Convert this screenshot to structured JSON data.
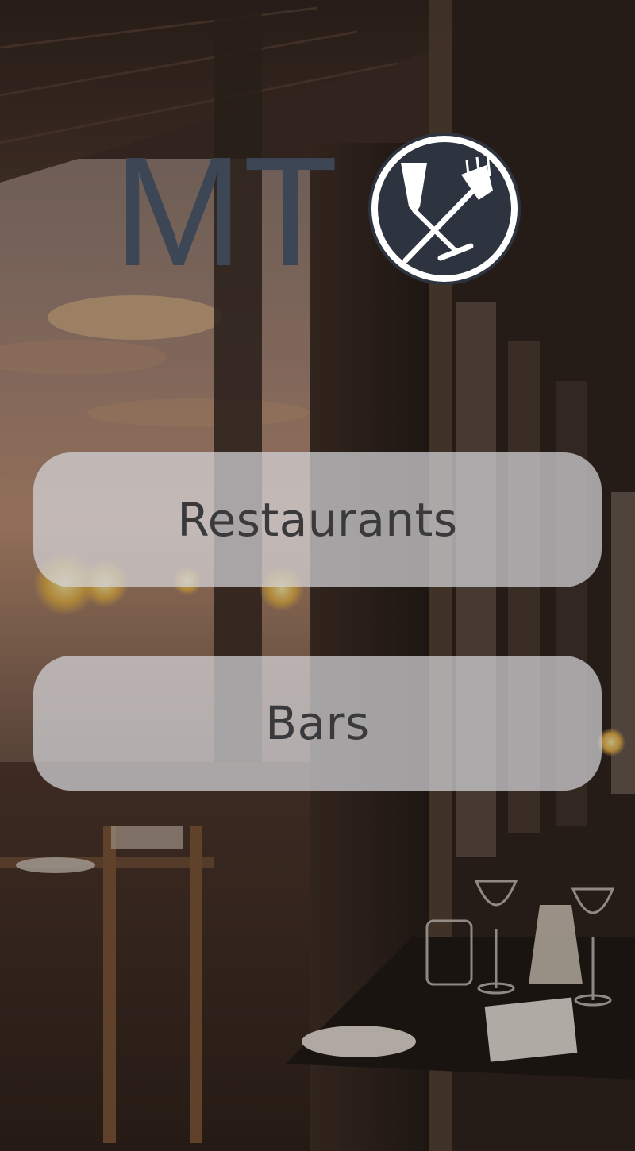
{
  "brand": {
    "logo_text": "MT",
    "logo_icon": "glass-and-fork-in-circle-icon",
    "logo_color": "#3d4654"
  },
  "menu": {
    "restaurants_label": "Restaurants",
    "bars_label": "Bars"
  },
  "background": {
    "scene": "restaurant-interior-photo"
  }
}
